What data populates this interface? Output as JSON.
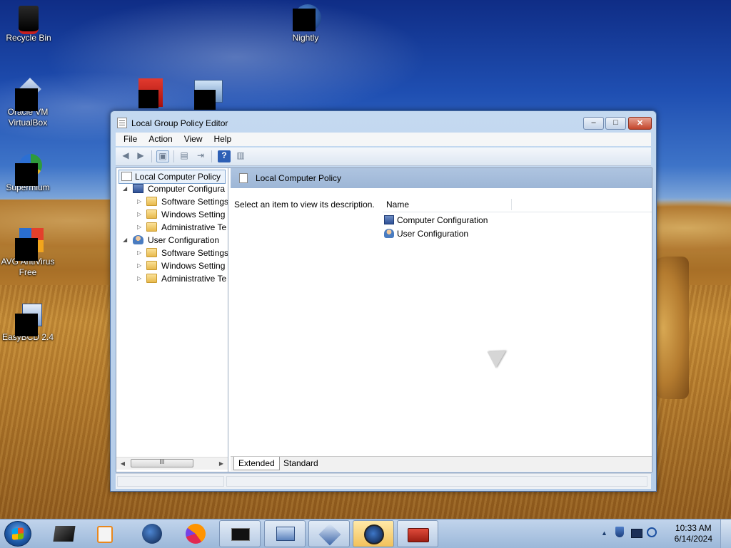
{
  "desktop": {
    "icons": [
      {
        "label": "Recycle Bin"
      },
      {
        "label": "Nightly"
      },
      {
        "label": "Oracle VM VirtualBox"
      },
      {
        "label": "Supermium"
      },
      {
        "label": "AVG AntiVirus Free"
      },
      {
        "label": "EasyBCD 2.4"
      }
    ]
  },
  "window": {
    "title": "Local Group Policy Editor",
    "controls": {
      "minimize": "–",
      "maximize": "□",
      "close": "✕"
    },
    "menu": [
      "File",
      "Action",
      "View",
      "Help"
    ],
    "toolbar": {
      "back": "◀",
      "forward": "▶",
      "show_hide_tree": "▣",
      "properties": "▤",
      "export": "⇥",
      "help": "?",
      "show_hide_action": "▥"
    },
    "tree": {
      "root": "Local Computer Policy",
      "computer": {
        "label": "Computer Configura",
        "children": [
          "Software Settings",
          "Windows Setting",
          "Administrative Te"
        ]
      },
      "user": {
        "label": "User Configuration",
        "children": [
          "Software Settings",
          "Windows Setting",
          "Administrative Te"
        ]
      },
      "scroll": {
        "left": "◀",
        "right": "▶",
        "grip": "III"
      }
    },
    "right_pane": {
      "header": "Local Computer Policy",
      "description": "Select an item to view its description.",
      "column_name": "Name",
      "items": [
        "Computer Configuration",
        "User Configuration"
      ],
      "tabs": [
        "Extended",
        "Standard"
      ]
    }
  },
  "taskbar": {
    "tray": {
      "chevron": "▲",
      "time": "10:33 AM",
      "date": "6/14/2024"
    }
  },
  "colors": {
    "window_frame": "#c4d9f0",
    "pane_header": "#aec4e0",
    "selected_tree_item": "#eaf2fb"
  }
}
